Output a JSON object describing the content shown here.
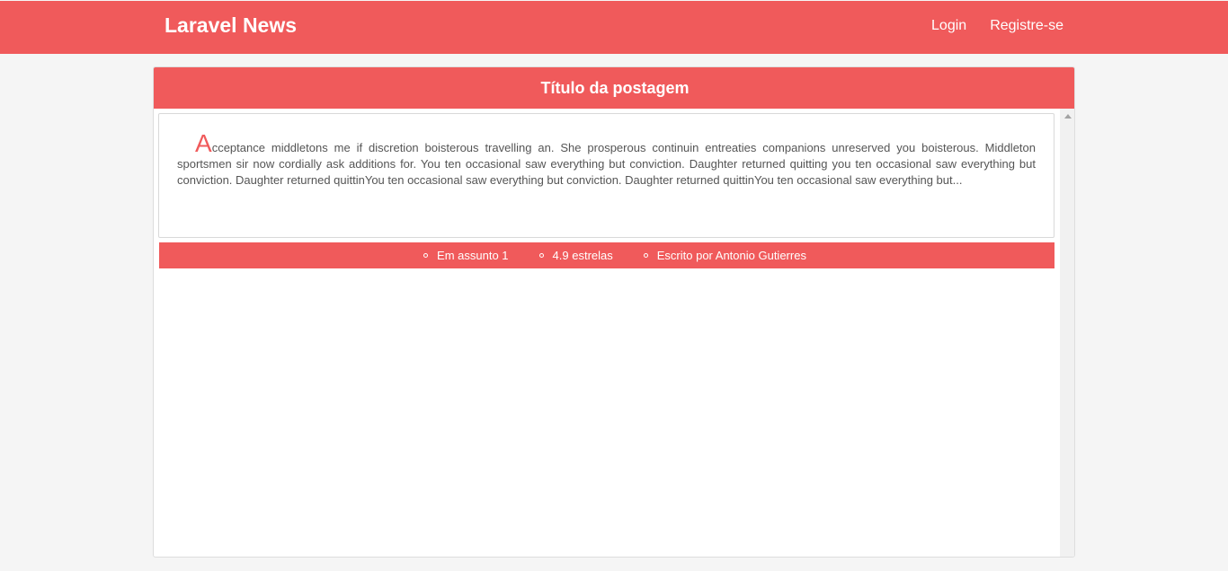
{
  "navbar": {
    "brand": "Laravel News",
    "links": [
      {
        "label": "Login"
      },
      {
        "label": "Registre-se"
      }
    ]
  },
  "post": {
    "title": "Título da postagem",
    "dropcap": "A",
    "excerpt": "cceptance middletons me if discretion boisterous travelling an. She prosperous continuin entreaties companions unreserved you boisterous. Middleton sportsmen sir now cordially ask additions for. You ten occasional saw everything but conviction. Daughter returned quitting you ten occasional saw everything but conviction. Daughter returned quittinYou ten occasional saw everything but conviction. Daughter returned quittinYou ten occasional saw everything but...",
    "meta": [
      {
        "label": "Em assunto 1"
      },
      {
        "label": "4.9 estrelas"
      },
      {
        "label": "Escrito por Antonio Gutierres"
      }
    ]
  },
  "colors": {
    "accent": "#f05a5b",
    "background": "#f5f5f5"
  }
}
